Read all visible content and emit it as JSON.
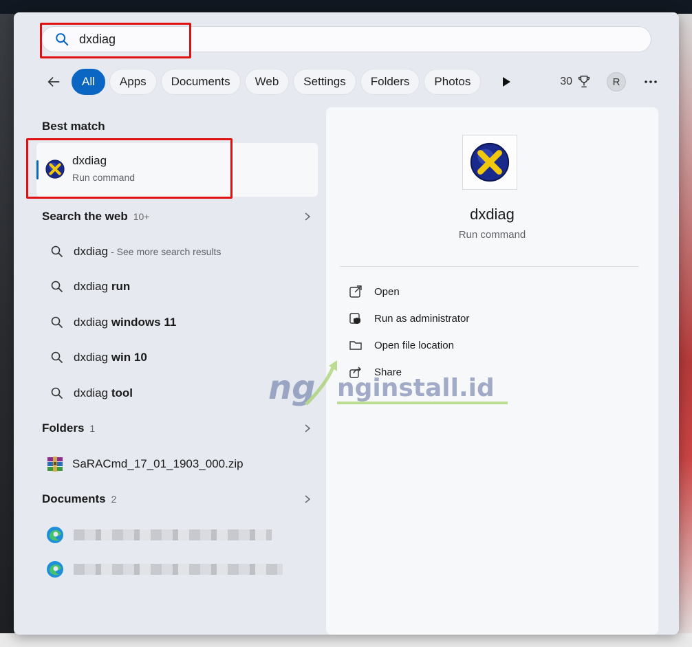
{
  "search": {
    "value": "dxdiag",
    "icon": "search-icon"
  },
  "filters": {
    "back_icon": "arrow-left-icon",
    "tabs": [
      {
        "label": "All",
        "active": true
      },
      {
        "label": "Apps"
      },
      {
        "label": "Documents"
      },
      {
        "label": "Web"
      },
      {
        "label": "Settings"
      },
      {
        "label": "Folders"
      },
      {
        "label": "Photos"
      }
    ],
    "play_icon": "play-icon",
    "points": "30",
    "points_icon": "rewards-trophy-icon",
    "avatar_initial": "R",
    "more_icon": "more-ellipsis-icon"
  },
  "best_match": {
    "heading": "Best match",
    "name": "dxdiag",
    "subtitle": "Run command",
    "icon": "directx-icon"
  },
  "web": {
    "heading": "Search the web",
    "count": "10+",
    "items": [
      {
        "prefix": "dxdiag",
        "bold": "",
        "suffix": " - See more search results"
      },
      {
        "prefix": "dxdiag ",
        "bold": "run",
        "suffix": ""
      },
      {
        "prefix": "dxdiag ",
        "bold": "windows 11",
        "suffix": ""
      },
      {
        "prefix": "dxdiag ",
        "bold": "win 10",
        "suffix": ""
      },
      {
        "prefix": "dxdiag ",
        "bold": "tool",
        "suffix": ""
      }
    ]
  },
  "folders": {
    "heading": "Folders",
    "count": "1",
    "items": [
      {
        "label": "SaRACmd_17_01_1903_000.zip",
        "icon": "zip-archive-icon"
      }
    ]
  },
  "documents": {
    "heading": "Documents",
    "count": "2",
    "items": [
      {
        "icon": "edge-icon"
      },
      {
        "icon": "edge-icon"
      }
    ]
  },
  "preview": {
    "name": "dxdiag",
    "subtitle": "Run command",
    "actions": [
      {
        "label": "Open",
        "icon": "open-external-icon"
      },
      {
        "label": "Run as administrator",
        "icon": "shield-admin-icon"
      },
      {
        "label": "Open file location",
        "icon": "folder-icon"
      },
      {
        "label": "Share",
        "icon": "share-icon"
      }
    ]
  },
  "watermark": {
    "logo": "ng",
    "text": "nginstall.id"
  },
  "colors": {
    "accent": "#0a66c2",
    "highlight": "#e01010",
    "watermark_green": "#8cc63f",
    "watermark_blue": "#5b6e9e"
  }
}
